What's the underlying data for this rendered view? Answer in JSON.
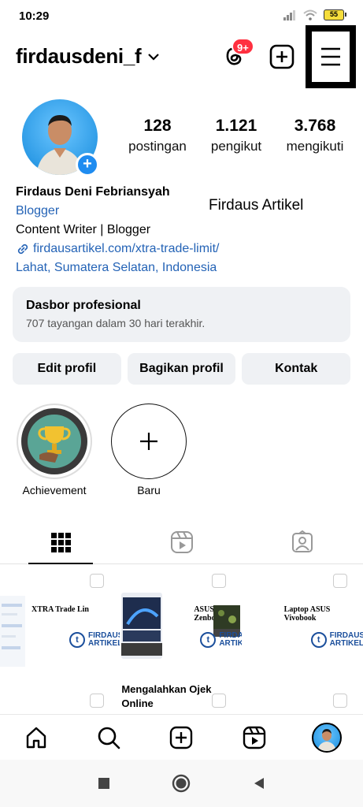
{
  "status_bar": {
    "time": "10:29",
    "battery": "55"
  },
  "header": {
    "username": "firdausdeni_f",
    "notification_badge": "9+"
  },
  "profile": {
    "stats": [
      {
        "value": "128",
        "label": "postingan"
      },
      {
        "value": "1.121",
        "label": "pengikut"
      },
      {
        "value": "3.768",
        "label": "mengikuti"
      }
    ],
    "name": "Firdaus Deni Febriansyah",
    "category": "Blogger",
    "bio": "Content Writer | Blogger",
    "link": "firdausartikel.com/xtra-trade-limit/",
    "location": "Lahat, Sumatera Selatan, Indonesia",
    "side_label": "Firdaus Artikel"
  },
  "dashboard": {
    "title": "Dasbor profesional",
    "subtitle": "707 tayangan dalam 30 hari terakhir."
  },
  "actions": {
    "edit": "Edit profil",
    "share": "Bagikan profil",
    "contact": "Kontak"
  },
  "highlights": [
    {
      "label": "Achievement"
    },
    {
      "label": "Baru"
    }
  ],
  "posts": [
    {
      "title": "XTRA Trade Lin",
      "brand_line1": "FIRDAUS",
      "brand_line2": "ARTIKEL"
    },
    {
      "title": "ASUS Zenbool",
      "brand_line1": "FIRDAU",
      "brand_line2": "ARTIKE"
    },
    {
      "title": "Laptop ASUS Vivobook",
      "brand_line1": "FIRDAUS",
      "brand_line2": "ARTIKEL"
    },
    {
      "caption": "Pengkolan Mengalahkan Ojek Online"
    }
  ]
}
